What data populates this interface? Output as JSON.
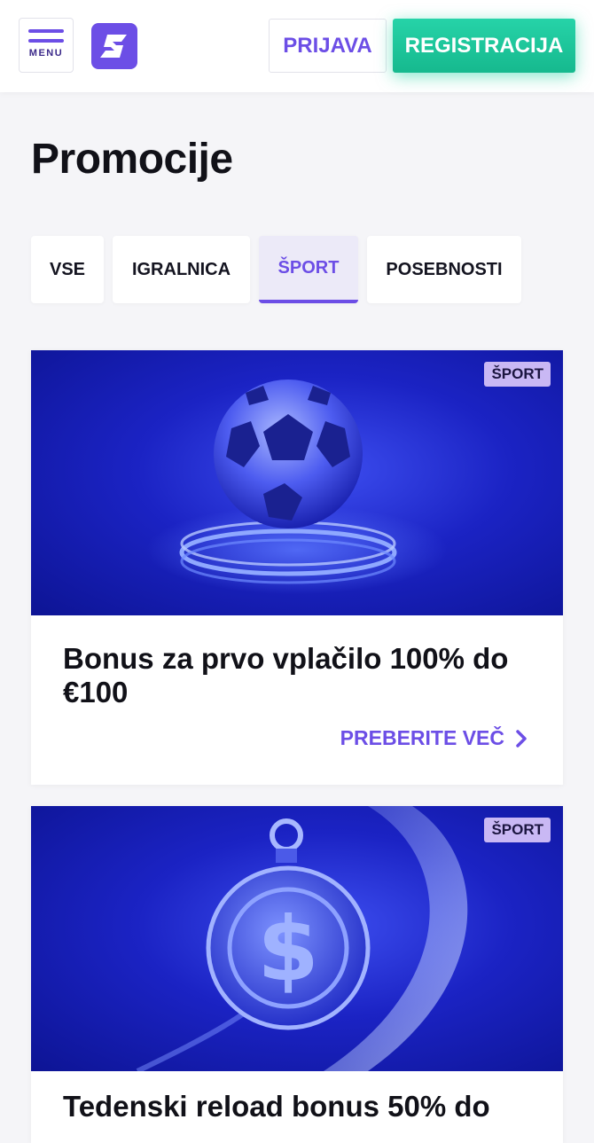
{
  "header": {
    "menu_label": "MENU",
    "login_label": "PRIJAVA",
    "register_label": "REGISTRACIJA"
  },
  "page": {
    "title": "Promocije"
  },
  "tabs": [
    {
      "label": "VSE",
      "active": false
    },
    {
      "label": "IGRALNICA",
      "active": false
    },
    {
      "label": "ŠPORT",
      "active": true
    },
    {
      "label": "POSEBNOSTI",
      "active": false
    }
  ],
  "promotions": [
    {
      "badge": "ŠPORT",
      "title": "Bonus za prvo vplačilo 100% do €100",
      "link": "PREBERITE VEČ",
      "image_icon": "soccer-ball-icon"
    },
    {
      "badge": "ŠPORT",
      "title": "Tedenski reload bonus 50% do",
      "image_icon": "stopwatch-dollar-icon"
    }
  ],
  "colors": {
    "accent": "#6c4ee6",
    "register": "#1ec79b",
    "badge_bg": "#c9b8f4",
    "promo_bg": "#1b23c4"
  }
}
